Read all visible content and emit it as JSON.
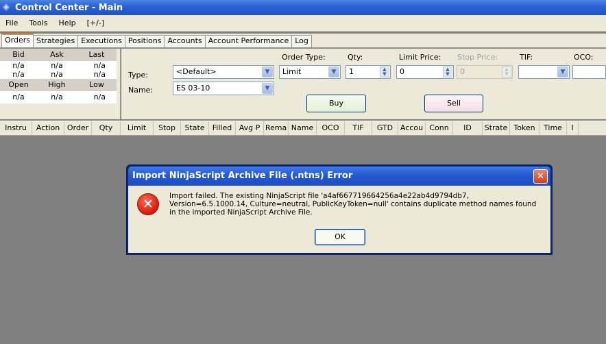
{
  "window": {
    "title": "Control Center - Main",
    "icon": "diamond-icon"
  },
  "menu": [
    "File",
    "Tools",
    "Help",
    "[+/-]"
  ],
  "tabs": [
    "Orders",
    "Strategies",
    "Executions",
    "Positions",
    "Accounts",
    "Account Performance",
    "Log"
  ],
  "active_tab": "Orders",
  "quote": {
    "headers_top": [
      "Bid",
      "Ask",
      "Last"
    ],
    "values_top": [
      [
        "n/a",
        "n/a",
        "n/a"
      ],
      [
        "n/a",
        "n/a",
        "n/a"
      ]
    ],
    "headers_bottom": [
      "Open",
      "High",
      "Low"
    ],
    "values_bottom": [
      "n/a",
      "n/a",
      "n/a"
    ]
  },
  "entry": {
    "type_label": "Type:",
    "type_value": "<Default>",
    "name_label": "Name:",
    "name_value": "ES 03-10",
    "order_type_label": "Order Type:",
    "order_type_value": "Limit",
    "qty_label": "Qty:",
    "qty_value": "1",
    "limit_label": "Limit Price:",
    "limit_value": "0",
    "stop_label": "Stop Price:",
    "stop_value": "0",
    "tif_label": "TIF:",
    "oco_label": "OCO:",
    "buy": "Buy",
    "sell": "Sell"
  },
  "columns": [
    "Instru",
    "Action",
    "Order",
    "Qty",
    "Limit",
    "Stop",
    "State",
    "Filled",
    "Avg P",
    "Rema",
    "Name",
    "OCO",
    "TIF",
    "GTD",
    "Accou",
    "Conn",
    "ID",
    "Strate",
    "Token",
    "Time",
    "I"
  ],
  "dialog": {
    "title": "Import NinjaScript Archive File (.ntns) Error",
    "message": "Import failed. The existing NinjaScript file 'a4af667719664256a4e22ab4d9794db7, Version=6.5.1000.14, Culture=neutral, PublicKeyToken=null' contains duplicate method names found in the imported NinjaScript Archive File.",
    "ok": "OK",
    "close_icon": "close-icon",
    "error_icon": "error-icon"
  }
}
